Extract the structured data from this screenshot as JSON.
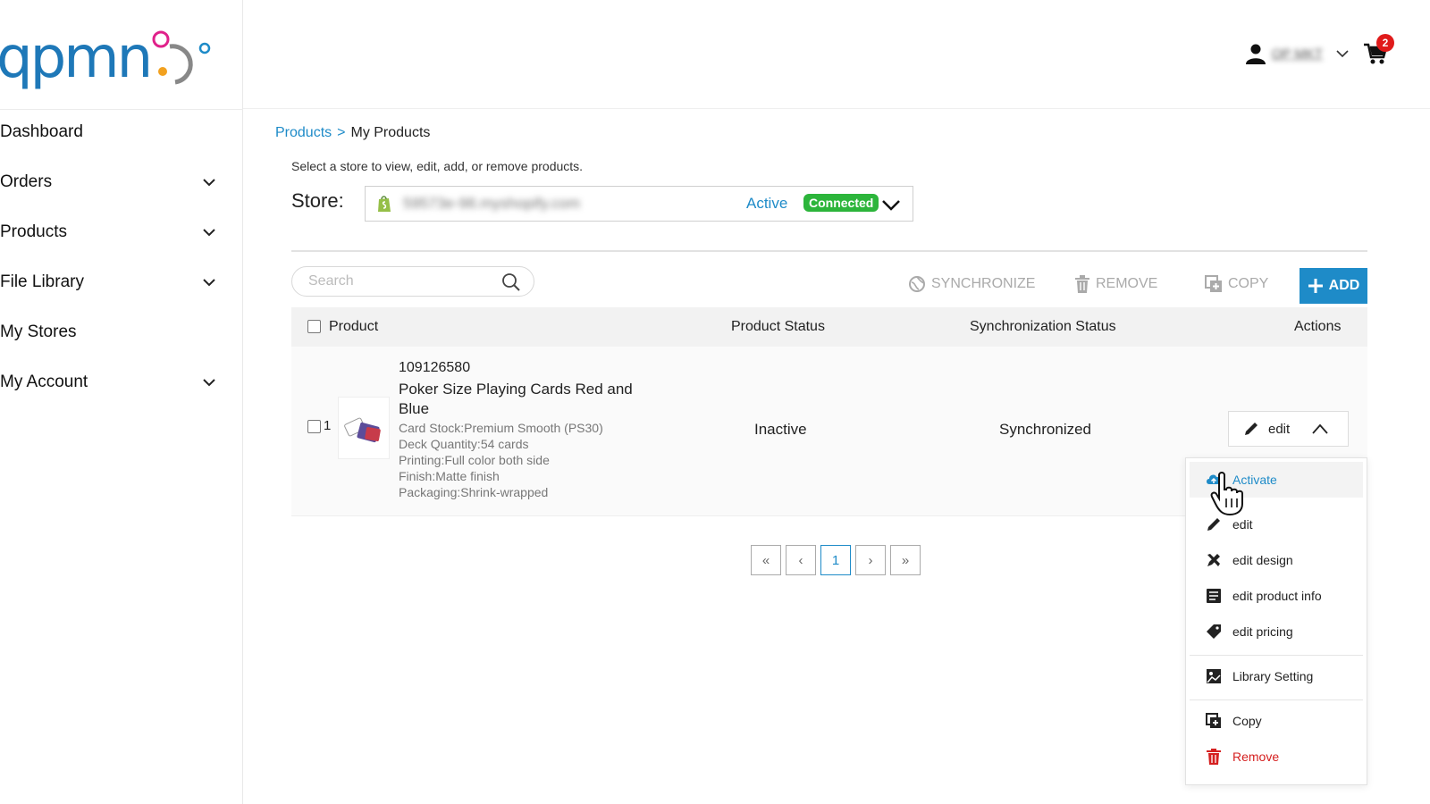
{
  "brand": {
    "logo_text": "apmn"
  },
  "sidebar": {
    "items": [
      {
        "label": "Dashboard",
        "has_children": false
      },
      {
        "label": "Orders",
        "has_children": true
      },
      {
        "label": "Products",
        "has_children": true
      },
      {
        "label": "File Library",
        "has_children": true
      },
      {
        "label": "My Stores",
        "has_children": false
      },
      {
        "label": "My Account",
        "has_children": true
      }
    ]
  },
  "header": {
    "user_name": "OP MKT",
    "cart_count": "2"
  },
  "breadcrumb": {
    "parent": "Products",
    "separator": ">",
    "current": "My Products"
  },
  "store": {
    "helper_text": "Select a store to view, edit, add, or remove products.",
    "label": "Store:",
    "url": "59573e-98.myshopify.com",
    "active_label": "Active",
    "connected_badge": "Connected"
  },
  "toolbar": {
    "search_placeholder": "Search",
    "synchronize_label": "SYNCHRONIZE",
    "remove_label": "REMOVE",
    "copy_label": "COPY",
    "add_label": "ADD"
  },
  "table": {
    "headers": {
      "product": "Product",
      "status": "Product Status",
      "sync": "Synchronization Status",
      "actions": "Actions"
    },
    "rows": [
      {
        "index": "1",
        "id": "109126580",
        "name": "Poker Size Playing Cards Red and Blue",
        "attributes": [
          "Card Stock:Premium Smooth (PS30)",
          "Deck Quantity:54 cards",
          "Printing:Full color both side",
          "Finish:Matte finish",
          "Packaging:Shrink-wrapped"
        ],
        "status": "Inactive",
        "sync_status": "Synchronized",
        "action_label": "edit"
      }
    ]
  },
  "pagination": {
    "first": "«",
    "prev": "‹",
    "current": "1",
    "next": "›",
    "last": "»"
  },
  "action_menu": {
    "items": [
      {
        "label": "Activate",
        "icon": "cloud-upload-icon"
      },
      {
        "label": "edit",
        "icon": "pencil-icon"
      },
      {
        "label": "edit design",
        "icon": "design-tools-icon"
      },
      {
        "label": "edit product info",
        "icon": "document-icon"
      },
      {
        "label": "edit pricing",
        "icon": "price-tag-icon"
      },
      {
        "label": "Library Setting",
        "icon": "library-image-icon"
      },
      {
        "label": "Copy",
        "icon": "copy-icon"
      },
      {
        "label": "Remove",
        "icon": "trash-icon"
      }
    ]
  },
  "colors": {
    "accent": "#1e8bc8",
    "success": "#2cb53b",
    "danger": "#d52020",
    "badge": "#e01b1b"
  }
}
